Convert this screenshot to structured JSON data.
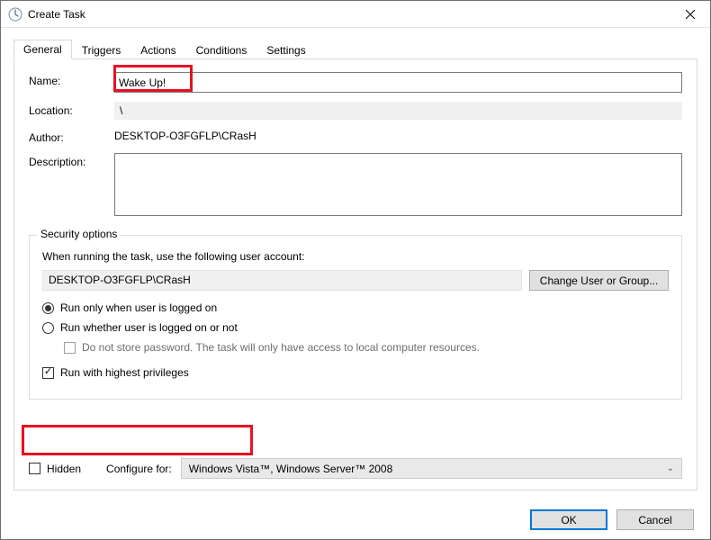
{
  "window": {
    "title": "Create Task"
  },
  "tabs": {
    "general": "General",
    "triggers": "Triggers",
    "actions": "Actions",
    "conditions": "Conditions",
    "settings": "Settings",
    "active": "general"
  },
  "form": {
    "name_label": "Name:",
    "name_value": "Wake Up!",
    "location_label": "Location:",
    "location_value": "\\",
    "author_label": "Author:",
    "author_value": "DESKTOP-O3FGFLP\\CRasH",
    "description_label": "Description:",
    "description_value": ""
  },
  "security": {
    "legend": "Security options",
    "prompt": "When running the task, use the following user account:",
    "account_value": "DESKTOP-O3FGFLP\\CRasH",
    "change_btn": "Change User or Group...",
    "radio1": "Run only when user is logged on",
    "radio2": "Run whether user is logged on or not",
    "radio_selected": 1,
    "dont_store": "Do not store password.  The task will only have access to local computer resources.",
    "highest": "Run with highest privileges",
    "highest_checked": true
  },
  "bottom": {
    "hidden_label": "Hidden",
    "hidden_checked": false,
    "configure_label": "Configure for:",
    "configure_value": "Windows Vista™, Windows Server™ 2008"
  },
  "buttons": {
    "ok": "OK",
    "cancel": "Cancel"
  }
}
